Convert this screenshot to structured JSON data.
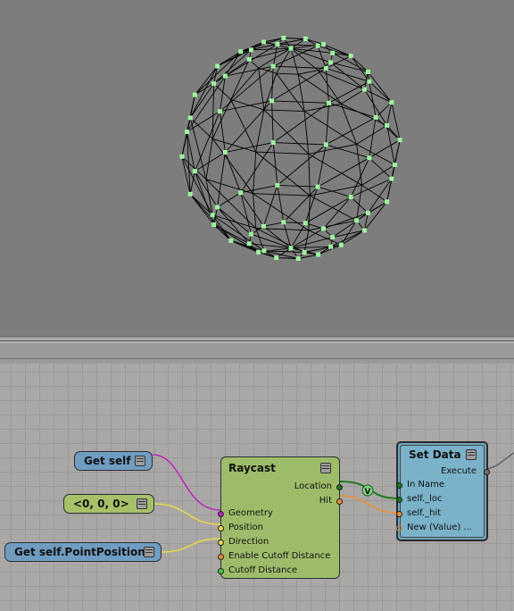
{
  "viewport": {
    "mesh_name": "sphere-wireframe",
    "vertex_color": "#9ff59f",
    "wire_color": "#000000",
    "background": "#7d7d7d"
  },
  "graph": {
    "nodes": {
      "get_self": {
        "label": "Get self",
        "color": "#6f9dc2"
      },
      "zero_vector": {
        "label": "<0, 0, 0>",
        "color": "#a7c06a"
      },
      "get_point_position": {
        "label": "Get self.PointPosition",
        "color": "#6f9dc2"
      },
      "raycast": {
        "title": "Raycast",
        "color": "#9dbc6a",
        "inputs": [
          "Geometry",
          "Position",
          "Direction",
          "Enable Cutoff Distance",
          "Cutoff Distance"
        ],
        "outputs": [
          "Location",
          "Hit"
        ]
      },
      "set_data": {
        "title": "Set Data",
        "color": "#7ab2c9",
        "execute": "Execute",
        "inputs": [
          "In Name",
          "self._loc",
          "self._hit",
          "New (Value) ..."
        ]
      }
    },
    "wire_colors": {
      "geometry": "#c020c0",
      "vector": "#e8d848",
      "location": "#1a7a1a",
      "hit": "#f09030",
      "execute": "#606060"
    },
    "convert_badge": "V"
  }
}
